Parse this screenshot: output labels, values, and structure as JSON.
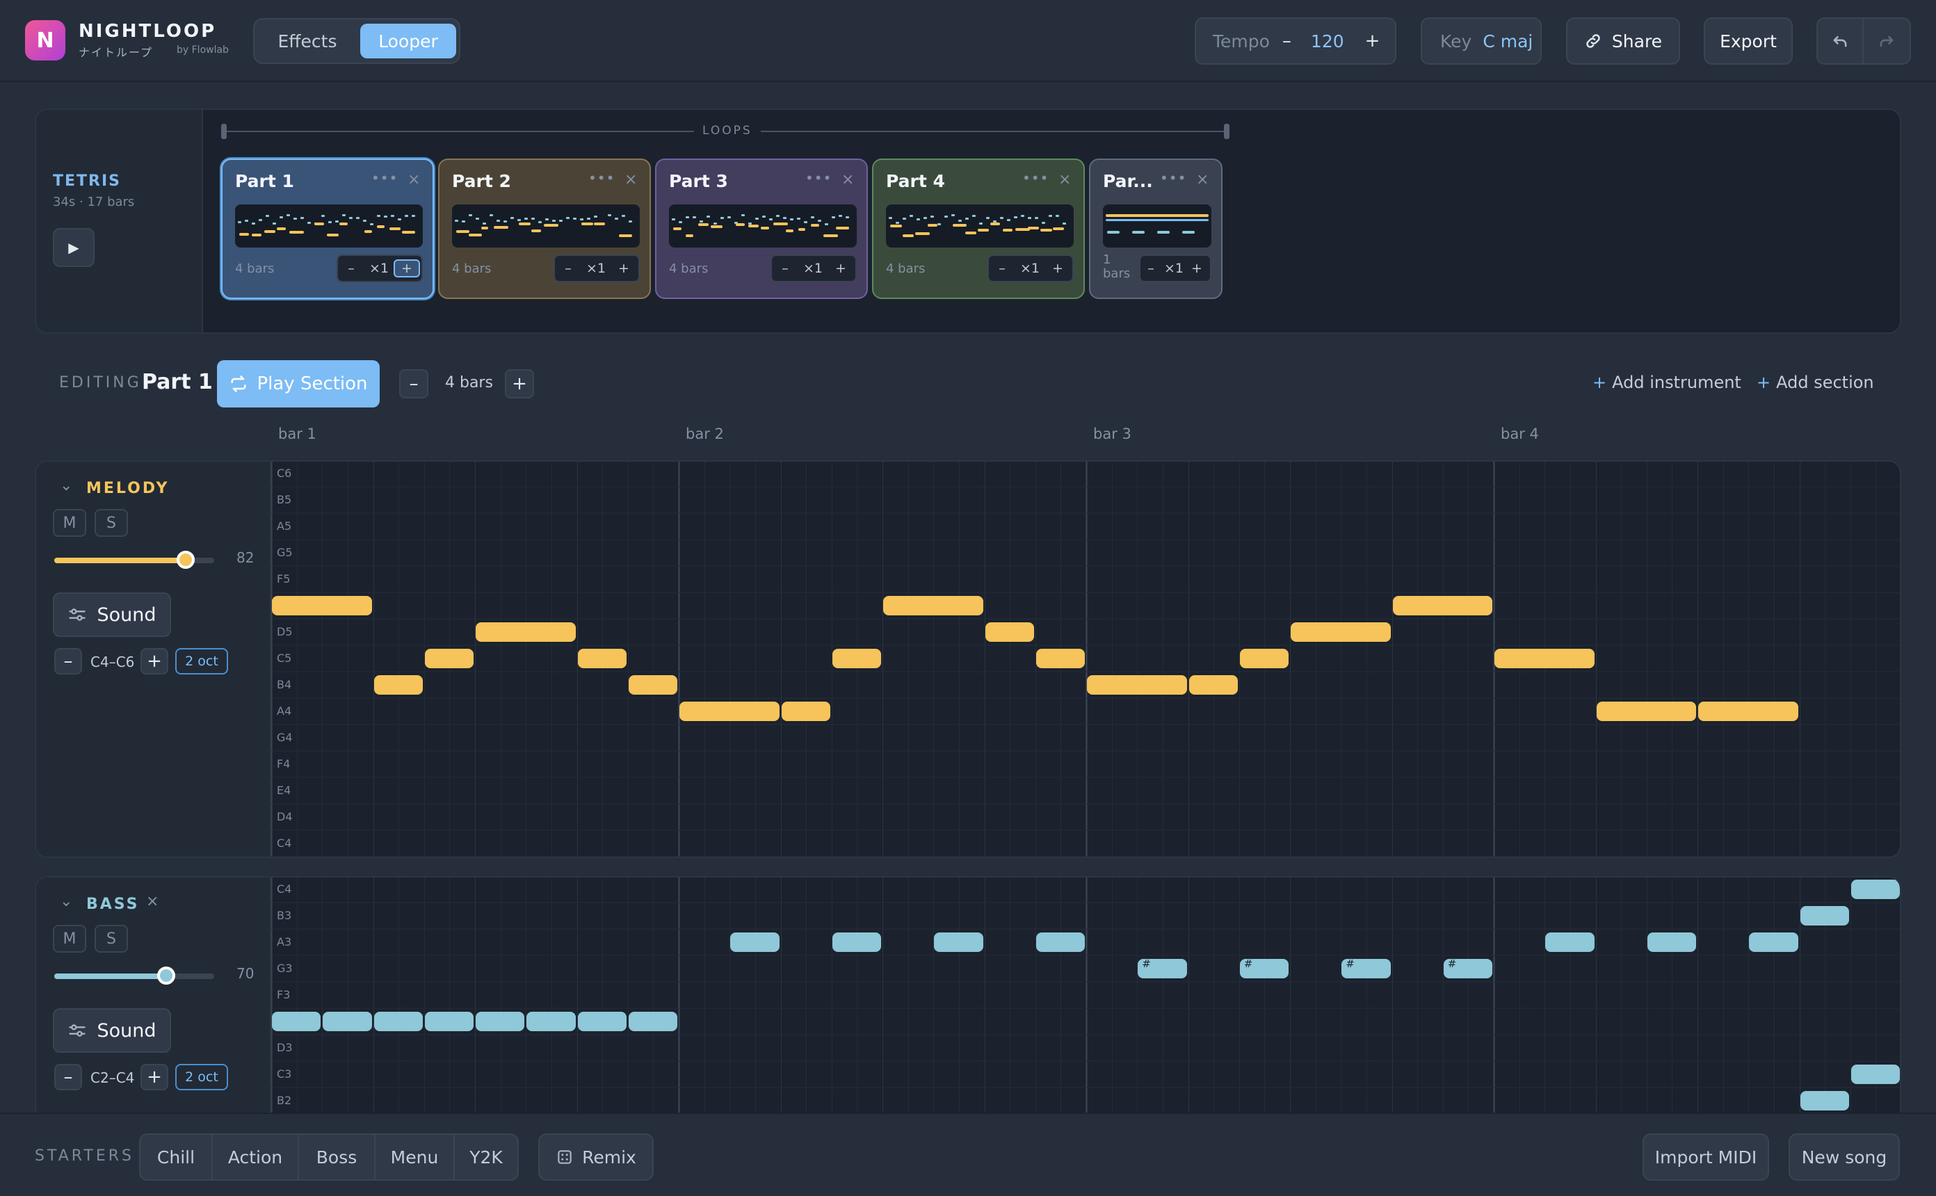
{
  "app": {
    "name": "NIGHTLOOP",
    "subtitle": "ナイトループ",
    "by": "by Flowlab",
    "logo_letter": "N"
  },
  "header": {
    "tabs": [
      {
        "label": "Effects",
        "active": false
      },
      {
        "label": "Looper",
        "active": true
      }
    ],
    "tempo": {
      "label": "Tempo",
      "minus": "–",
      "value": "120",
      "plus": "+"
    },
    "key": {
      "label": "Key",
      "value": "C maj"
    },
    "share_label": "Share",
    "export_label": "Export",
    "undo_icon": "undo-icon",
    "redo_icon": "redo-icon"
  },
  "song": {
    "title": "TETRIS",
    "meta": "34s · 17 bars"
  },
  "loops": {
    "label": "LOOPS",
    "parts": [
      {
        "name": "Part 1",
        "bars": "4 bars",
        "repeat": "×1",
        "selected": true,
        "color": "#4b7fb8"
      },
      {
        "name": "Part 2",
        "bars": "4 bars",
        "repeat": "×1",
        "selected": false,
        "color": "#8a7356"
      },
      {
        "name": "Part 3",
        "bars": "4 bars",
        "repeat": "×1",
        "selected": false,
        "color": "#6f62a0"
      },
      {
        "name": "Part 4",
        "bars": "4 bars",
        "repeat": "×1",
        "selected": false,
        "color": "#5d8a5d"
      },
      {
        "name": "Par...",
        "bars_num": "1",
        "bars_unit": "bars",
        "repeat": "×1",
        "selected": false,
        "color": "#5f6b7e"
      }
    ],
    "dots": "•••",
    "close": "×",
    "minus": "–",
    "plus": "+"
  },
  "editing": {
    "label": "EDITING",
    "section": "Part 1",
    "play_label": "Play Section",
    "bars": "4 bars",
    "minus": "–",
    "plus": "+",
    "add_instrument": "Add instrument",
    "add_section": "Add section",
    "add_plus": "+"
  },
  "bar_labels": [
    "bar 1",
    "bar 2",
    "bar 3",
    "bar 4"
  ],
  "tracks": {
    "melody": {
      "name": "MELODY",
      "color": "#f6c45b",
      "mute": "M",
      "solo": "S",
      "volume": 82,
      "volume_label": "82",
      "sound_label": "Sound",
      "range": "C4–C6",
      "octaves": "2 oct",
      "minus": "–",
      "plus": "+",
      "pitches": [
        "C6",
        "B5",
        "A5",
        "G5",
        "F5",
        "E5",
        "D5",
        "C5",
        "B4",
        "A4",
        "G4",
        "F4",
        "E4",
        "D4",
        "C4"
      ],
      "notes": [
        {
          "row": 5,
          "start": 0,
          "len": 4
        },
        {
          "row": 8,
          "start": 4,
          "len": 2
        },
        {
          "row": 7,
          "start": 6,
          "len": 2
        },
        {
          "row": 6,
          "start": 8,
          "len": 4
        },
        {
          "row": 7,
          "start": 12,
          "len": 2
        },
        {
          "row": 8,
          "start": 14,
          "len": 2
        },
        {
          "row": 9,
          "start": 16,
          "len": 4
        },
        {
          "row": 9,
          "start": 20,
          "len": 2
        },
        {
          "row": 7,
          "start": 22,
          "len": 2
        },
        {
          "row": 5,
          "start": 24,
          "len": 4
        },
        {
          "row": 6,
          "start": 28,
          "len": 2
        },
        {
          "row": 7,
          "start": 30,
          "len": 2
        },
        {
          "row": 8,
          "start": 32,
          "len": 4
        },
        {
          "row": 8,
          "start": 36,
          "len": 2
        },
        {
          "row": 7,
          "start": 38,
          "len": 2
        },
        {
          "row": 6,
          "start": 40,
          "len": 4
        },
        {
          "row": 5,
          "start": 44,
          "len": 4
        },
        {
          "row": 7,
          "start": 48,
          "len": 4
        },
        {
          "row": 9,
          "start": 52,
          "len": 4
        },
        {
          "row": 9,
          "start": 56,
          "len": 4
        }
      ]
    },
    "bass": {
      "name": "BASS",
      "color": "#8fc8d8",
      "close": "×",
      "mute": "M",
      "solo": "S",
      "volume": 70,
      "volume_label": "70",
      "sound_label": "Sound",
      "range": "C2–C4",
      "octaves": "2 oct",
      "minus": "–",
      "plus": "+",
      "sharp": "#",
      "pitches": [
        "C4",
        "B3",
        "A3",
        "G3",
        "F3",
        "E3",
        "D3",
        "C3",
        "B2"
      ],
      "notes": [
        {
          "row": 5,
          "start": 0,
          "len": 2
        },
        {
          "row": 5,
          "start": 2,
          "len": 2
        },
        {
          "row": 5,
          "start": 4,
          "len": 2
        },
        {
          "row": 5,
          "start": 6,
          "len": 2
        },
        {
          "row": 5,
          "start": 8,
          "len": 2
        },
        {
          "row": 5,
          "start": 10,
          "len": 2
        },
        {
          "row": 5,
          "start": 12,
          "len": 2
        },
        {
          "row": 5,
          "start": 14,
          "len": 2
        },
        {
          "row": 2,
          "start": 18,
          "len": 2
        },
        {
          "row": 2,
          "start": 22,
          "len": 2
        },
        {
          "row": 2,
          "start": 26,
          "len": 2
        },
        {
          "row": 2,
          "start": 30,
          "len": 2
        },
        {
          "row": 3,
          "start": 34,
          "len": 2,
          "sharp": true
        },
        {
          "row": 3,
          "start": 38,
          "len": 2,
          "sharp": true
        },
        {
          "row": 3,
          "start": 42,
          "len": 2,
          "sharp": true
        },
        {
          "row": 3,
          "start": 46,
          "len": 2,
          "sharp": true
        },
        {
          "row": 2,
          "start": 50,
          "len": 2
        },
        {
          "row": 2,
          "start": 54,
          "len": 2
        },
        {
          "row": 2,
          "start": 58,
          "len": 2
        },
        {
          "row": 1,
          "start": 60,
          "len": 2
        },
        {
          "row": 0,
          "start": 62,
          "len": 2
        },
        {
          "row": 8,
          "start": 60,
          "len": 2
        },
        {
          "row": 7,
          "start": 62,
          "len": 2
        }
      ]
    }
  },
  "footer": {
    "starters_label": "STARTERS",
    "starters": [
      "Chill",
      "Action",
      "Boss",
      "Menu",
      "Y2K"
    ],
    "remix_label": "Remix",
    "import_label": "Import MIDI",
    "new_song_label": "New song"
  }
}
